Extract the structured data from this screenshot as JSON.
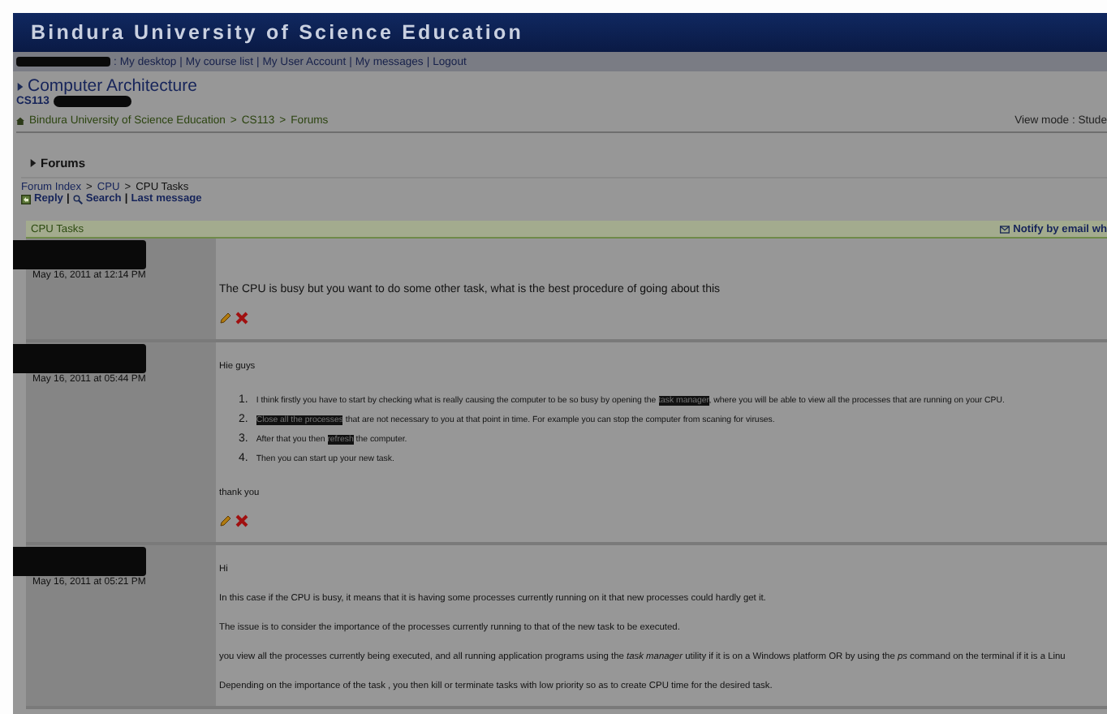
{
  "site_title": "Bindura University of Science Education",
  "user_nav": {
    "lead": ":",
    "separator": "|",
    "links": [
      "My desktop",
      "My course list",
      "My User Account",
      "My messages",
      "Logout"
    ]
  },
  "course": {
    "title": "Computer Architecture",
    "code": "CS113"
  },
  "breadcrumb": {
    "separator": ">",
    "items": [
      "Bindura University of Science Education",
      "CS113",
      "Forums"
    ]
  },
  "view_mode": "View mode : Stude",
  "section_title": "Forums",
  "forum_path": {
    "separator": ">",
    "items": [
      "Forum Index",
      "CPU",
      "CPU Tasks"
    ]
  },
  "actions": {
    "separator": "|",
    "items": [
      {
        "kind": "reply",
        "label": "Reply"
      },
      {
        "kind": "search",
        "label": "Search"
      },
      {
        "kind": "plain",
        "label": "Last message"
      }
    ]
  },
  "thread": {
    "title": "CPU Tasks",
    "notify": "Notify by email wh"
  },
  "posts": [
    {
      "date": "May 16, 2011 at 12:14 PM",
      "tools": true,
      "blocks": [
        {
          "kind": "lead",
          "text": "The CPU is busy but you want to do some other task, what is the best procedure of going about this"
        }
      ]
    },
    {
      "date": "May 16, 2011 at 05:44 PM",
      "tools": true,
      "blocks": [
        {
          "kind": "para",
          "text": "Hie guys"
        },
        {
          "kind": "list",
          "items": [
            {
              "number": "1.",
              "segments": [
                {
                  "text": "I think firstly you have to start by checking what is really causing the computer to be so busy by opening the ",
                  "highlighted": false
                },
                {
                  "text": "task manager",
                  "highlighted": true
                },
                {
                  "text": ", where you will be able to view all the processes that are running on your CPU.",
                  "highlighted": false
                }
              ]
            },
            {
              "number": "2.",
              "segments": [
                {
                  "text": "Close all the processes",
                  "highlighted": true
                },
                {
                  "text": " that are not necessary to you at that point in time. For example you can stop the computer from scaning for viruses.",
                  "highlighted": false
                }
              ]
            },
            {
              "number": "3.",
              "segments": [
                {
                  "text": "After that you then ",
                  "highlighted": false
                },
                {
                  "text": "refresh",
                  "highlighted": true
                },
                {
                  "text": " the computer.",
                  "highlighted": false
                }
              ]
            },
            {
              "number": "4.",
              "segments": [
                {
                  "text": "Then you can start up your new task.",
                  "highlighted": false
                }
              ]
            }
          ]
        },
        {
          "kind": "para",
          "text": "thank you"
        }
      ]
    },
    {
      "date": "May 16, 2011 at 05:21 PM",
      "blocks": [
        {
          "kind": "para",
          "text": "Hi"
        },
        {
          "kind": "para",
          "text": "In this case if the CPU is busy, it means that it is having some processes currently running on it that new processes could hardly get it."
        },
        {
          "kind": "para",
          "text": "The issue is to consider the importance of the processes currently running to that of the new task to be executed."
        },
        {
          "kind": "para",
          "text": "you view all the processes currently being executed, and all running application programs using the *task manager* utility if it is on a Windows platform OR by using the *ps* command on the terminal if it is a Linu"
        },
        {
          "kind": "para",
          "text": "Depending on the importance of the task , you then kill or terminate  tasks with low priority so as to create CPU time for the desired task."
        }
      ]
    }
  ]
}
